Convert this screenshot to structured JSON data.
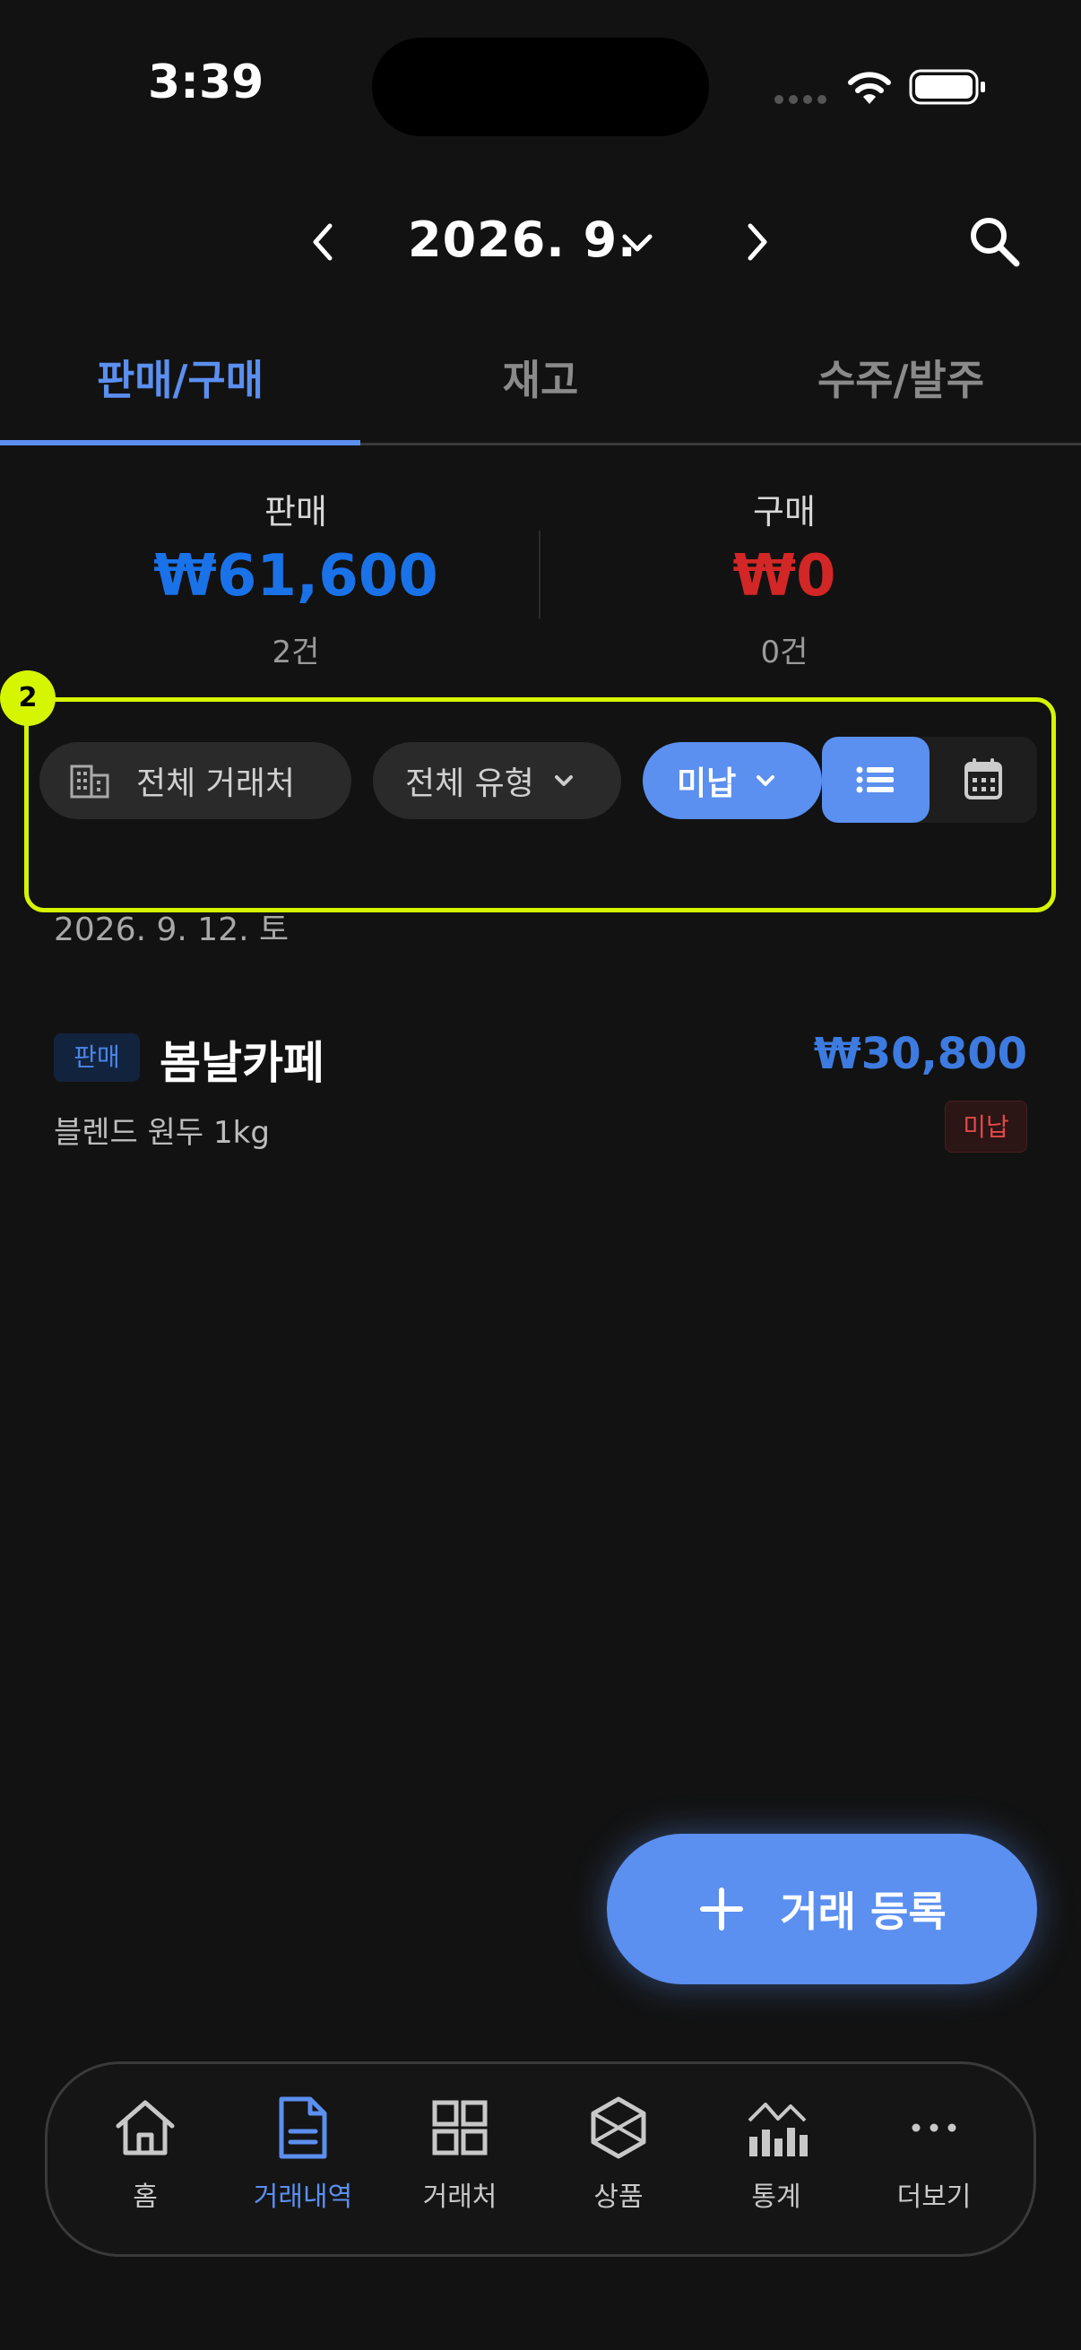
{
  "status_bar": {
    "time": "3:39"
  },
  "header": {
    "month": "2026. 9."
  },
  "tabs": [
    {
      "label": "판매/구매",
      "active": true
    },
    {
      "label": "재고",
      "active": false
    },
    {
      "label": "수주/발주",
      "active": false
    }
  ],
  "summary": {
    "sale": {
      "label": "판매",
      "amount": "₩61,600",
      "count": "2건",
      "color": "#1a72e8"
    },
    "purchase": {
      "label": "구매",
      "amount": "₩0",
      "count": "0건",
      "color": "#d32626"
    }
  },
  "filters": {
    "vendor": "전체 거래처",
    "type": "전체 유형",
    "payment": "미납",
    "badge": "2"
  },
  "list": {
    "date_header": "2026. 9. 12. 토",
    "items": [
      {
        "type": "판매",
        "title": "봄날카페",
        "amount": "₩30,800",
        "description": "블렌드 원두 1kg",
        "status": "미납"
      }
    ]
  },
  "fab": {
    "label": "거래 등록"
  },
  "bottom_nav": [
    {
      "label": "홈",
      "icon": "home-icon",
      "active": false
    },
    {
      "label": "거래내역",
      "icon": "document-icon",
      "active": true
    },
    {
      "label": "거래처",
      "icon": "grid-icon",
      "active": false
    },
    {
      "label": "상품",
      "icon": "box-icon",
      "active": false
    },
    {
      "label": "통계",
      "icon": "stats-icon",
      "active": false
    },
    {
      "label": "더보기",
      "icon": "more-icon",
      "active": false
    }
  ],
  "colors": {
    "accent": "#5b8ff0",
    "background": "#121212",
    "highlight": "#d6f500"
  }
}
